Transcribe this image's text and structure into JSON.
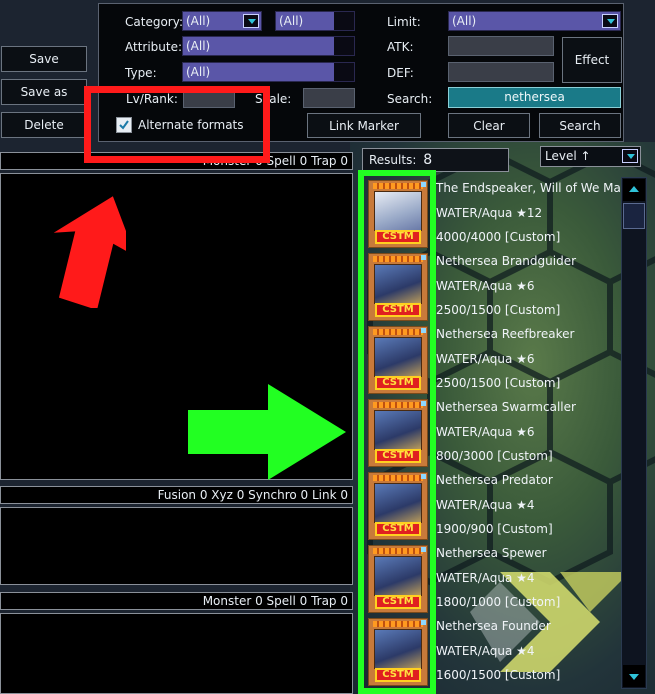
{
  "actions": {
    "save": "Save",
    "save_as": "Save as",
    "delete": "Delete"
  },
  "filters": {
    "category_label": "Category:",
    "category_value": "(All)",
    "category2_value": "(All)",
    "attribute_label": "Attribute:",
    "attribute_value": "(All)",
    "type_label": "Type:",
    "type_value": "(All)",
    "lvrank_label": "Lv/Rank:",
    "scale_label": "Scale:",
    "alternate_formats_label": "Alternate formats",
    "alternate_formats_checked": true,
    "limit_label": "Limit:",
    "limit_value": "(All)",
    "atk_label": "ATK:",
    "def_label": "DEF:",
    "search_label": "Search:",
    "search_value": "nethersea",
    "effect_button": "Effect",
    "link_marker_button": "Link Marker",
    "clear_button": "Clear",
    "search_button": "Search"
  },
  "deck": {
    "main_counts": "Monster 0 Spell 0 Trap 0",
    "extra_counts": "Fusion 0 Xyz 0 Synchro 0 Link 0",
    "side_counts": "Monster 0 Spell 0 Trap 0"
  },
  "results": {
    "label": "Results:",
    "count": "8",
    "sort_value": "Level ↑",
    "items": [
      {
        "name": "The Endspeaker, Will of We Many",
        "type": "WATER/Aqua ★12",
        "stats": "4000/4000 [Custom]",
        "badge": "CSTM"
      },
      {
        "name": "Nethersea Brandguider",
        "type": "WATER/Aqua ★6",
        "stats": "2500/1500 [Custom]",
        "badge": "CSTM"
      },
      {
        "name": "Nethersea Reefbreaker",
        "type": "WATER/Aqua ★6",
        "stats": "2500/1500 [Custom]",
        "badge": "CSTM"
      },
      {
        "name": "Nethersea Swarmcaller",
        "type": "WATER/Aqua ★6",
        "stats": "800/3000 [Custom]",
        "badge": "CSTM"
      },
      {
        "name": "Nethersea Predator",
        "type": "WATER/Aqua ★4",
        "stats": "1900/900 [Custom]",
        "badge": "CSTM"
      },
      {
        "name": "Nethersea Spewer",
        "type": "WATER/Aqua ★4",
        "stats": "1800/1000 [Custom]",
        "badge": "CSTM"
      },
      {
        "name": "Nethersea Founder",
        "type": "WATER/Aqua ★4",
        "stats": "1600/1500 [Custom]",
        "badge": "CSTM"
      }
    ]
  },
  "colors": {
    "highlight_red": "#ff1a1a",
    "highlight_green": "#22ff22",
    "field_purple": "#5a56a8",
    "search_teal": "#1a7a88"
  }
}
